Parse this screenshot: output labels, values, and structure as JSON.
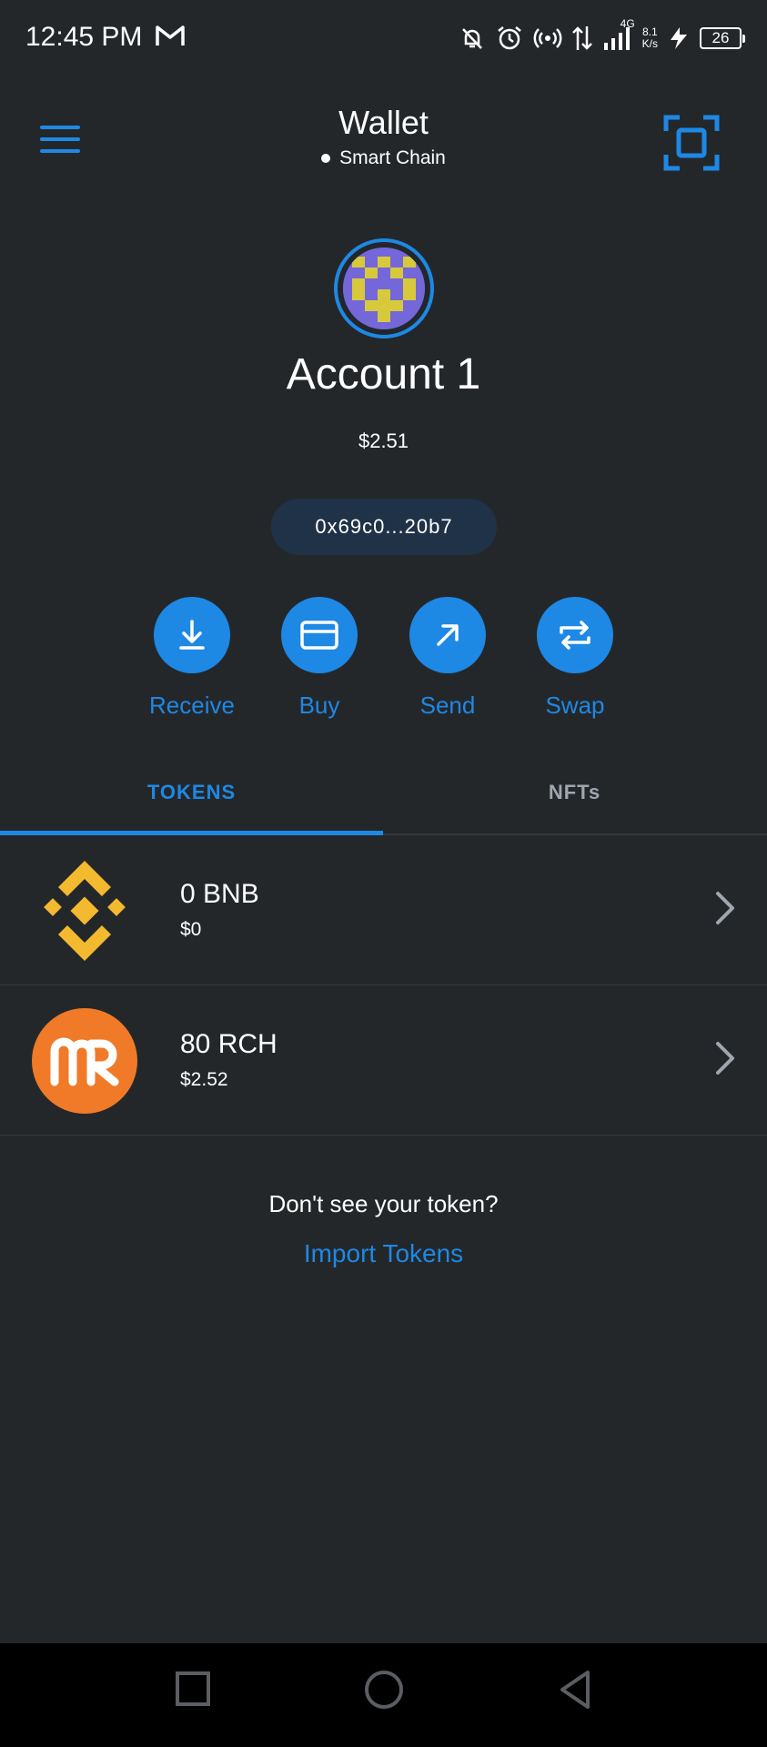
{
  "status_bar": {
    "time": "12:45 PM",
    "network_type": "4G",
    "speed_value": "8.1",
    "speed_unit": "K/s",
    "battery": "26",
    "icons": [
      "gmail-icon",
      "notifications-off-icon",
      "alarm-icon",
      "hotspot-icon",
      "data-arrows-icon",
      "signal-icon",
      "charging-icon",
      "battery-icon"
    ]
  },
  "header": {
    "title": "Wallet",
    "network": "Smart Chain",
    "menu_icon": "hamburger-menu-icon",
    "scan_icon": "qr-scan-icon"
  },
  "account": {
    "name": "Account 1",
    "balance": "$2.51",
    "address": "0x69c0...20b7"
  },
  "actions": [
    {
      "label": "Receive",
      "icon": "download-icon"
    },
    {
      "label": "Buy",
      "icon": "credit-card-icon"
    },
    {
      "label": "Send",
      "icon": "arrow-up-right-icon"
    },
    {
      "label": "Swap",
      "icon": "swap-arrows-icon"
    }
  ],
  "tabs": [
    {
      "label": "TOKENS",
      "active": true
    },
    {
      "label": "NFTs",
      "active": false
    }
  ],
  "tokens": [
    {
      "amount": "0 BNB",
      "fiat": "$0",
      "icon": "bnb-logo-icon",
      "color": "#f3ba2f"
    },
    {
      "amount": "80 RCH",
      "fiat": "$2.52",
      "icon": "rch-logo-icon",
      "color": "#f07a28"
    }
  ],
  "import": {
    "prompt": "Don't see your token?",
    "link": "Import Tokens"
  },
  "colors": {
    "background": "#24272a",
    "accent": "#1e88e5",
    "address_pill": "#1f3247"
  }
}
